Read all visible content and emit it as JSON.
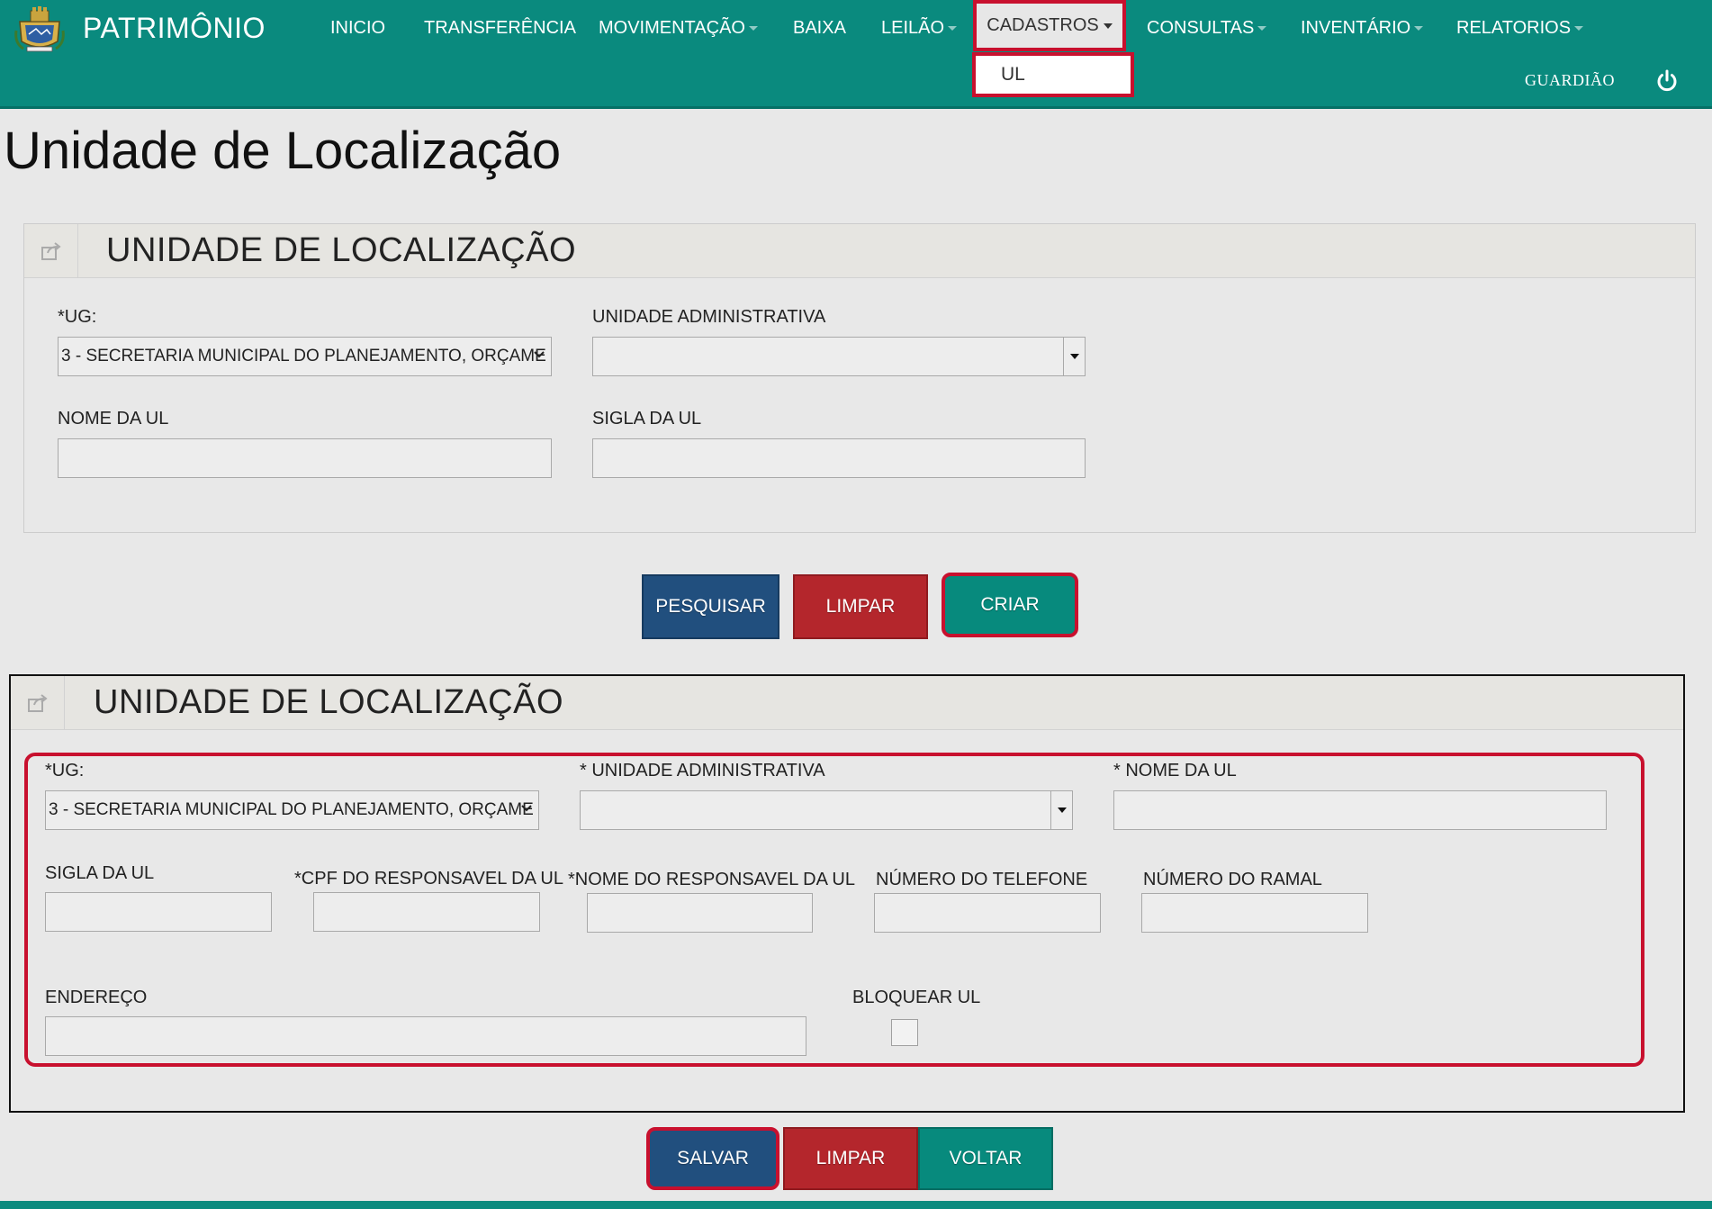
{
  "app": {
    "name": "PATRIMÔNIO"
  },
  "nav": {
    "items": [
      {
        "label": "INICIO"
      },
      {
        "label": "TRANSFERÊNCIA"
      },
      {
        "label": "MOVIMENTAÇÃO"
      },
      {
        "label": "BAIXA"
      },
      {
        "label": "LEILÃO"
      },
      {
        "label": "CADASTROS"
      },
      {
        "label": "CONSULTAS"
      },
      {
        "label": "INVENTÁRIO"
      },
      {
        "label": "RELATORIOS"
      }
    ],
    "dropdown_item": "UL",
    "user": "GUARDIÃO"
  },
  "page": {
    "title": "Unidade de Localização"
  },
  "search_panel": {
    "title": "UNIDADE DE LOCALIZAÇÃO",
    "ug_label": "*UG:",
    "ug_value": "3 - SECRETARIA MUNICIPAL DO PLANEJAMENTO, ORÇAME",
    "ua_label": "UNIDADE ADMINISTRATIVA",
    "nome_label": "NOME DA UL",
    "sigla_label": "SIGLA DA UL",
    "buttons": {
      "pesquisar": "PESQUISAR",
      "limpar": "LIMPAR",
      "criar": "CRIAR"
    }
  },
  "form_panel": {
    "title": "UNIDADE DE LOCALIZAÇÃO",
    "ug_label": "*UG:",
    "ug_value": "3 - SECRETARIA MUNICIPAL DO PLANEJAMENTO, ORÇAME",
    "ua_label": "* UNIDADE ADMINISTRATIVA",
    "nome_label": "* NOME DA UL",
    "sigla_label": "SIGLA DA UL",
    "cpf_label": "*CPF DO RESPONSAVEL DA UL",
    "nome_resp_label": "*NOME DO RESPONSAVEL DA UL",
    "telefone_label": "NÚMERO DO TELEFONE",
    "ramal_label": "NÚMERO DO RAMAL",
    "endereco_label": "ENDEREÇO",
    "bloquear_label": "BLOQUEAR UL",
    "bloquear_checked": false,
    "buttons": {
      "salvar": "SALVAR",
      "limpar": "LIMPAR",
      "voltar": "VOLTAR"
    }
  },
  "colors": {
    "navbar": "#0a8a7e",
    "highlight": "#c8102e",
    "btn_blue": "#214f7e",
    "btn_red": "#b4262c",
    "btn_green": "#078a7d"
  }
}
